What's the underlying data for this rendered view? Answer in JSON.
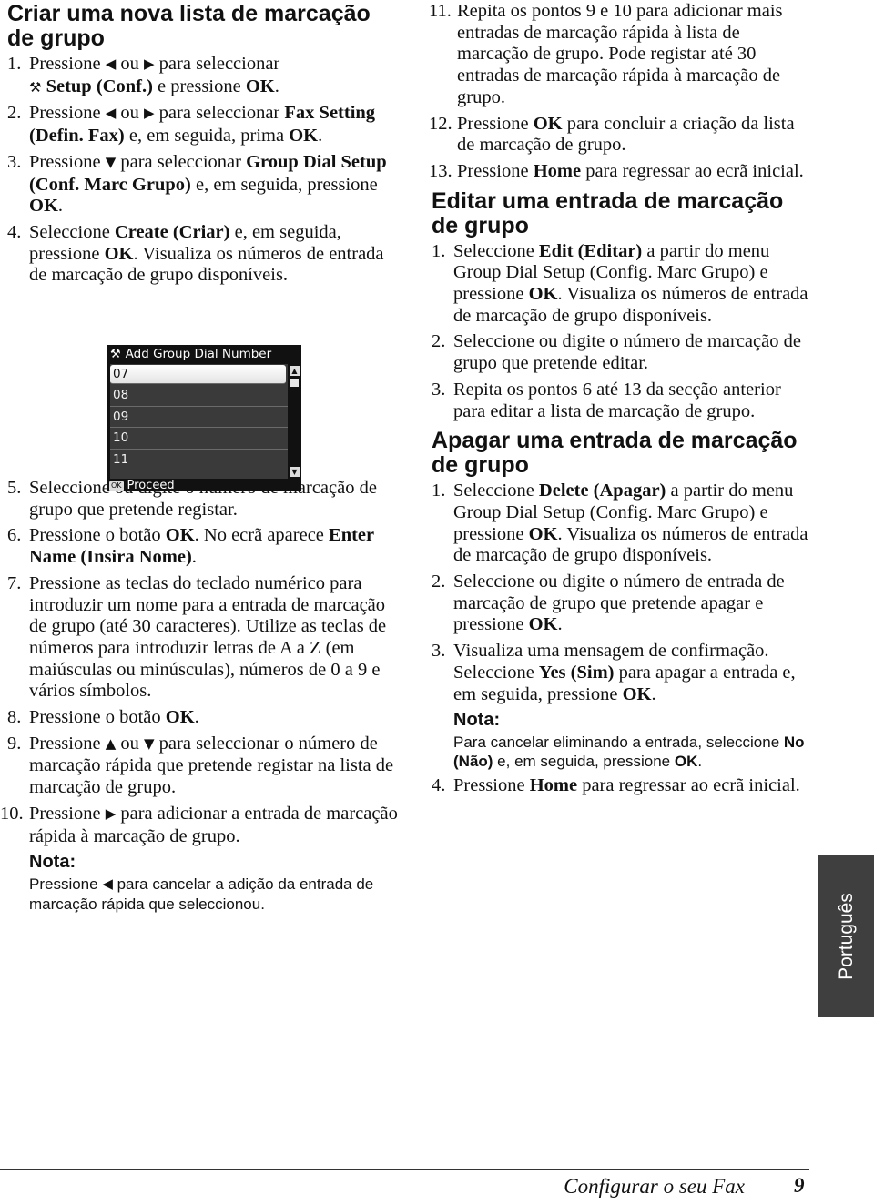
{
  "left_column": {
    "heading": "Criar uma nova lista de marcação de grupo",
    "steps": [
      {
        "num": "1.",
        "parts": [
          "Pressione ",
          "◀",
          " ou ",
          "▶",
          " para seleccionar ",
          "Setup (Conf.)",
          " e pressione ",
          "OK",
          "."
        ],
        "setup_icon": "wrench-screwdriver-icon"
      },
      {
        "num": "2.",
        "parts": [
          "Pressione ",
          "◀",
          " ou ",
          "▶",
          " para seleccionar ",
          "Fax Setting (Defin. Fax)",
          " e, em seguida, prima ",
          "OK",
          "."
        ]
      },
      {
        "num": "3.",
        "parts": [
          "Pressione ",
          "▼",
          " para seleccionar ",
          "Group Dial Setup (Conf. Marc Grupo)",
          " e, em seguida, pressione ",
          "OK",
          "."
        ]
      },
      {
        "num": "4.",
        "parts": [
          "Seleccione ",
          "Create (Criar)",
          " e, em seguida, pressione ",
          "OK",
          ". Visualiza os números de entrada de marcação de grupo disponíveis."
        ]
      },
      {
        "num": "5.",
        "parts": [
          "Seleccione ou digite o número de marcação de grupo que pretende registar."
        ]
      },
      {
        "num": "6.",
        "parts": [
          "Pressione o botão ",
          "OK",
          ". No ecrã aparece ",
          "Enter Name (Insira Nome)",
          "."
        ]
      },
      {
        "num": "7.",
        "parts": [
          "Pressione as teclas do teclado numérico para introduzir um nome para a entrada de marcação de grupo (até 30 caracteres). Utilize as teclas de números para introduzir letras de A a Z (em maiúsculas ou minúsculas), números de 0 a 9 e vários símbolos."
        ]
      },
      {
        "num": "8.",
        "parts": [
          "Pressione o botão ",
          "OK",
          "."
        ]
      },
      {
        "num": "9.",
        "parts": [
          "Pressione ",
          "▲",
          " ou ",
          "▼",
          " para seleccionar o número de marcação rápida que pretende registar na lista de marcação de grupo."
        ]
      },
      {
        "num": "10.",
        "parts": [
          "Pressione ",
          "▶",
          " para adicionar a entrada de marcação rápida à marcação de grupo."
        ]
      }
    ],
    "note": {
      "title": "Nota:",
      "parts": [
        "Pressione ",
        "◀",
        " para cancelar a adição da entrada de marcação rápida que seleccionou."
      ]
    }
  },
  "lcd": {
    "title": "Add Group Dial Number",
    "title_icon": "wrench-screwdriver-icon",
    "items": [
      "07",
      "08",
      "09",
      "10",
      "11"
    ],
    "selected_index": 0,
    "scroll_up": "▲",
    "scroll_down": "▼",
    "footer_badge": "OK",
    "footer_label": "Proceed"
  },
  "right_column": {
    "steps_continued": [
      {
        "num": "11.",
        "parts": [
          "Repita os pontos 9 e 10 para adicionar mais entradas de marcação rápida à lista de marcação de grupo. Pode registar até 30 entradas de marcação rápida à marcação de grupo."
        ]
      },
      {
        "num": "12.",
        "parts": [
          "Pressione ",
          "OK",
          " para concluir a criação da lista de marcação de grupo."
        ]
      },
      {
        "num": "13.",
        "parts": [
          "Pressione ",
          "Home",
          " para regressar ao ecrã inicial."
        ]
      }
    ],
    "edit_section": {
      "heading": "Editar uma entrada de marcação de grupo",
      "steps": [
        {
          "num": "1.",
          "parts": [
            "Seleccione ",
            "Edit (Editar)",
            " a partir do menu Group Dial Setup (Config. Marc Grupo) e pressione ",
            "OK",
            ". Visualiza os números de entrada de marcação de grupo disponíveis."
          ]
        },
        {
          "num": "2.",
          "parts": [
            "Seleccione ou digite o número de marcação de grupo que pretende editar."
          ]
        },
        {
          "num": "3.",
          "parts": [
            "Repita os pontos 6 até 13 da secção anterior para editar a lista de marcação de grupo."
          ]
        }
      ]
    },
    "delete_section": {
      "heading": "Apagar uma entrada de marcação de grupo",
      "steps": [
        {
          "num": "1.",
          "parts": [
            "Seleccione ",
            "Delete (Apagar)",
            " a partir do menu Group Dial Setup (Config. Marc Grupo) e pressione ",
            "OK",
            ". Visualiza os números de entrada de marcação de grupo disponíveis."
          ]
        },
        {
          "num": "2.",
          "parts": [
            "Seleccione ou digite o número de entrada de marcação de grupo que pretende apagar e pressione ",
            "OK",
            "."
          ]
        },
        {
          "num": "3.",
          "parts": [
            "Visualiza uma mensagem de confirmação. Seleccione ",
            "Yes (Sim)",
            " para apagar a entrada e, em seguida, pressione ",
            "OK",
            "."
          ]
        },
        {
          "num": "4.",
          "parts": [
            "Pressione ",
            "Home",
            " para regressar ao ecrã inicial."
          ]
        }
      ],
      "note": {
        "title": "Nota:",
        "parts": [
          "Para cancelar eliminando a entrada, seleccione ",
          "No (Não)",
          " e, em seguida, pressione ",
          "OK",
          "."
        ]
      }
    }
  },
  "side_tab": {
    "label": "Português",
    "color": "#3f3f3f"
  },
  "footer": {
    "section_title": "Configurar o seu Fax",
    "page_number": "9"
  }
}
